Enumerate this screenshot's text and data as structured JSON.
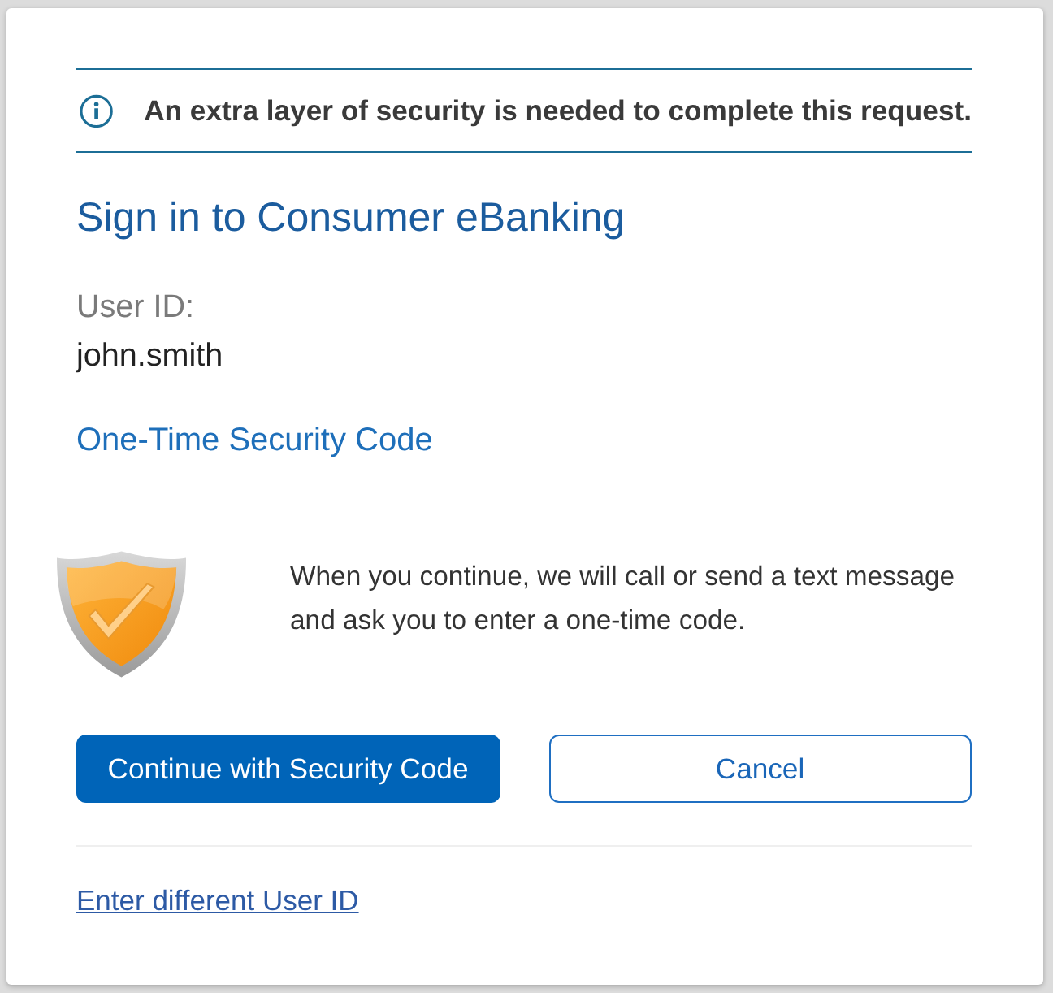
{
  "notice": {
    "text": "An extra layer of security is needed to complete this request."
  },
  "title": "Sign in to Consumer eBanking",
  "user_id": {
    "label": "User ID:",
    "value": "john.smith"
  },
  "method_link": "One-Time Security Code",
  "message": "When you continue, we will call or send a text message and ask you to enter a one-time code.",
  "buttons": [
    {
      "label": "Continue with Security Code",
      "kind": "primary"
    },
    {
      "label": "Cancel",
      "kind": "secondary"
    }
  ],
  "footer_link": "Enter different User ID"
}
